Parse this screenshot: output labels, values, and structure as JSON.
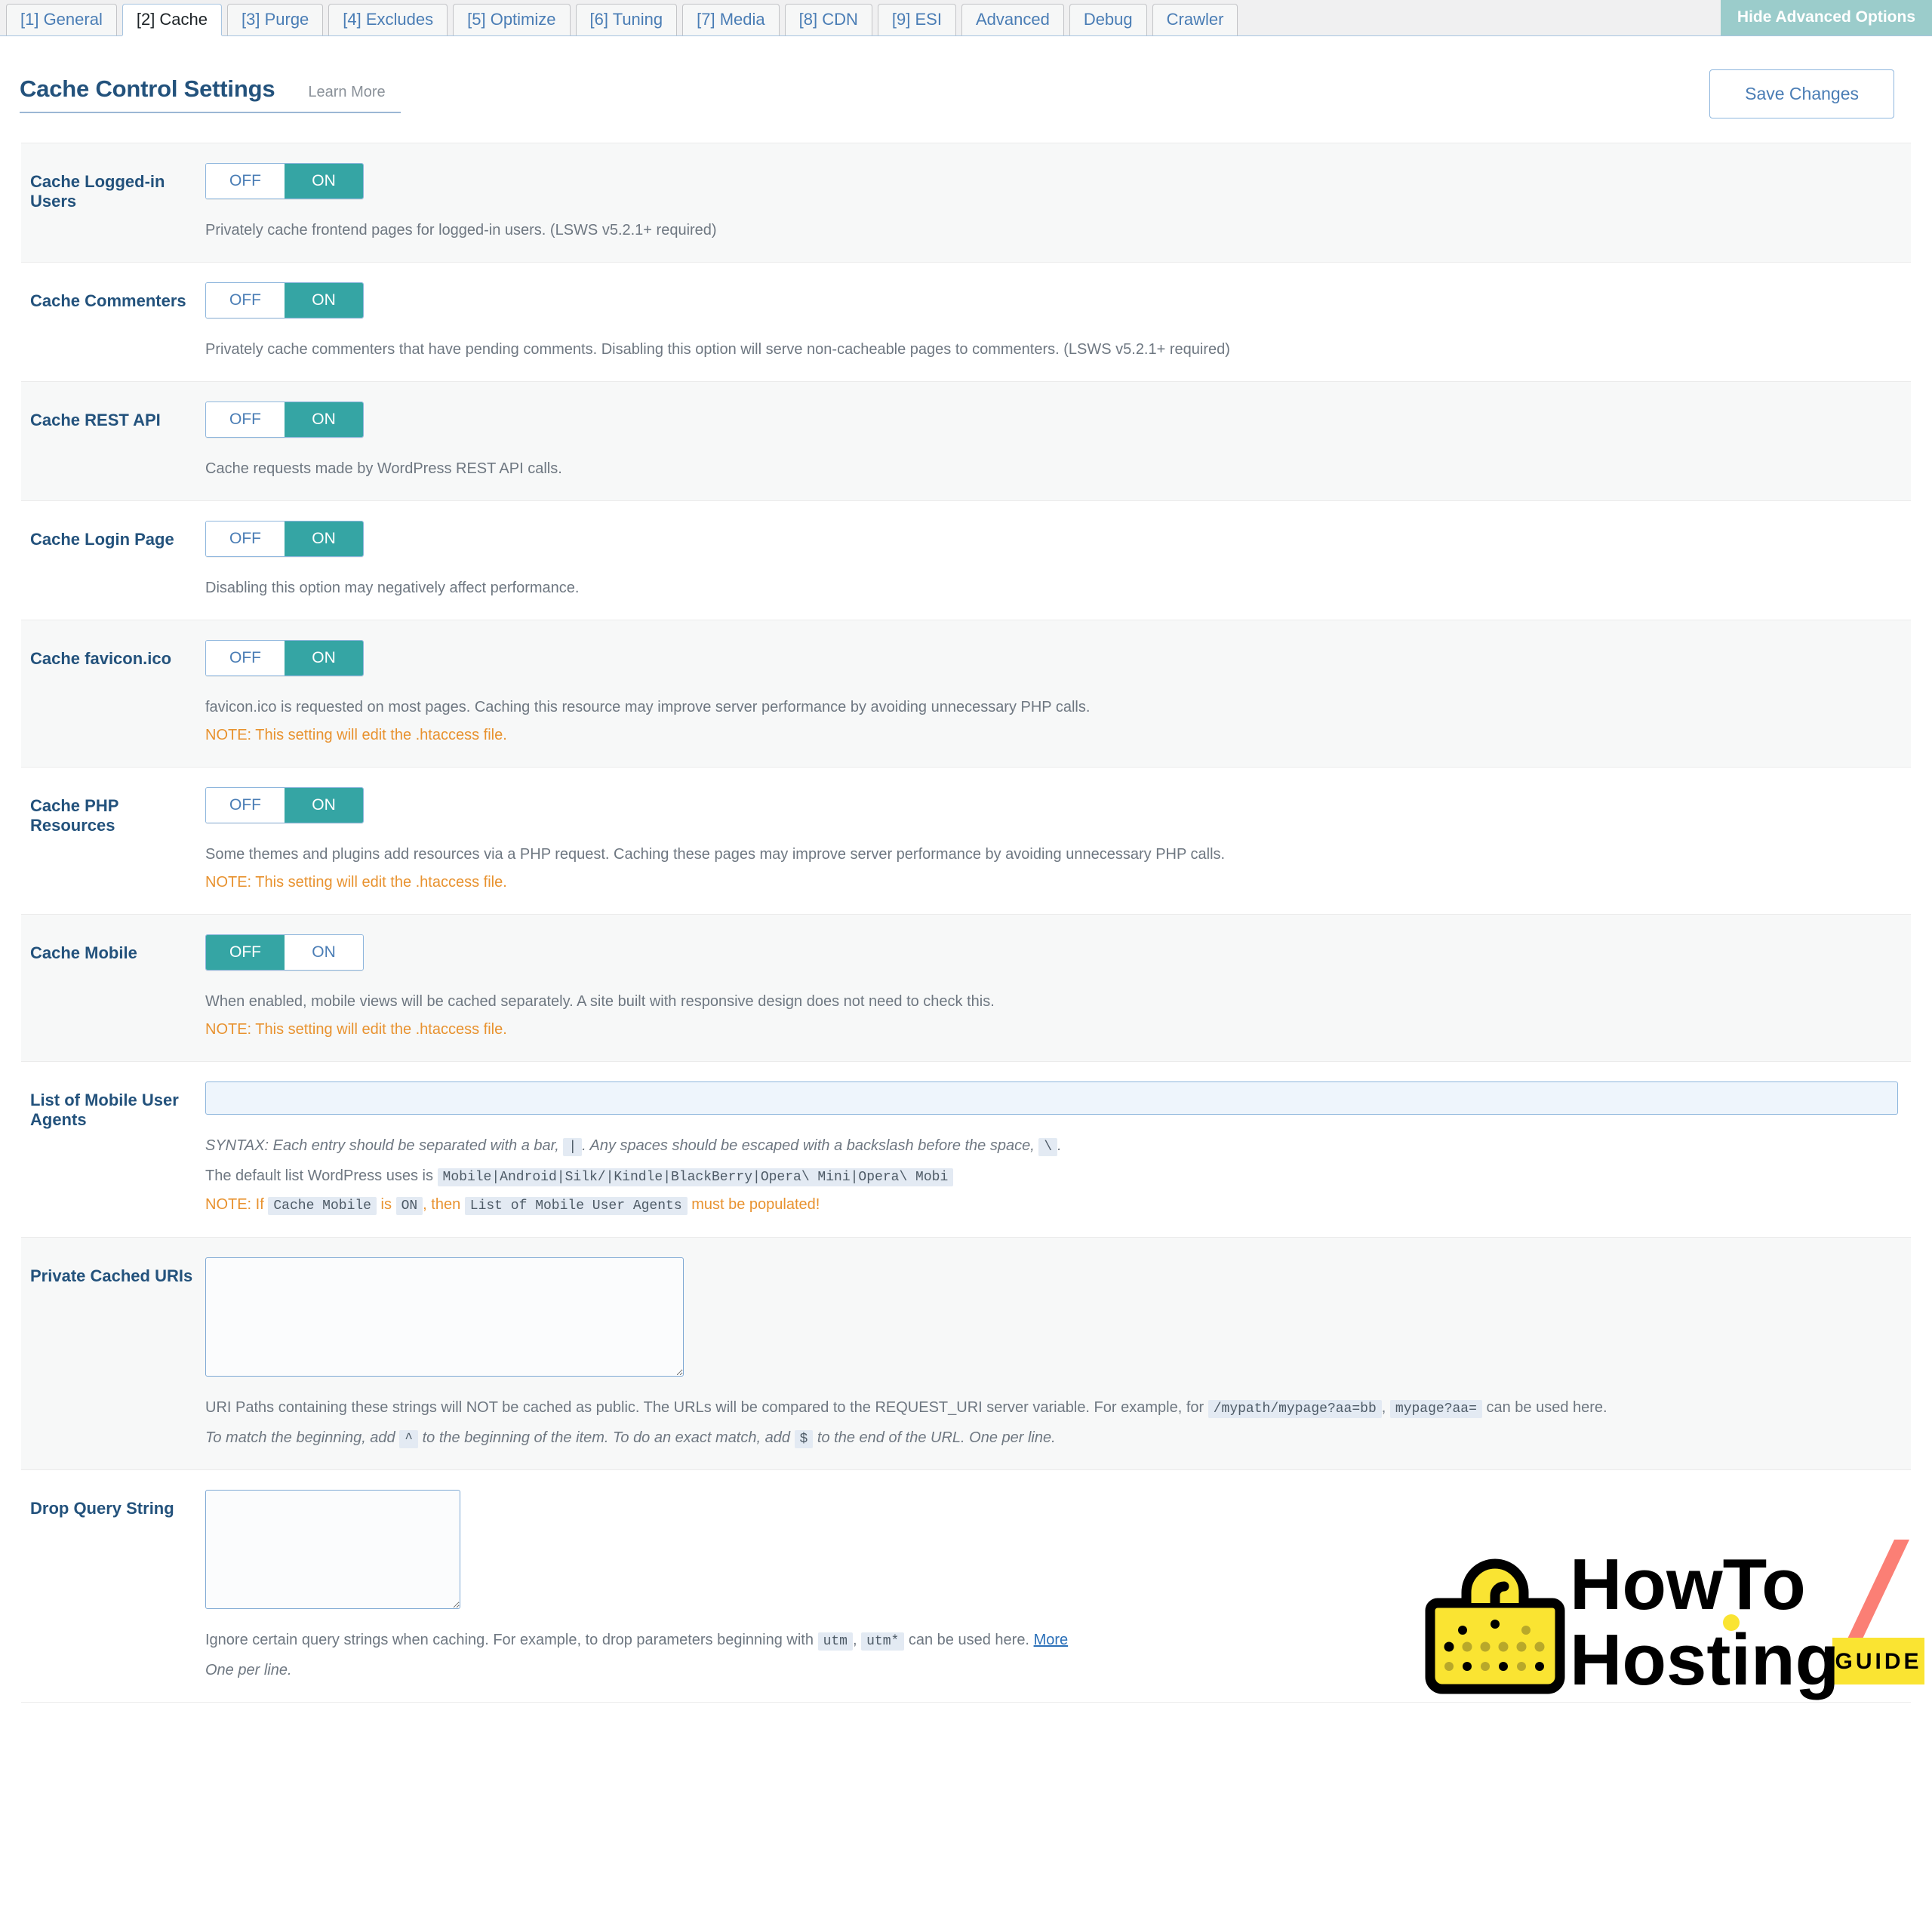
{
  "tabs": [
    {
      "label": "[1] General",
      "active": false
    },
    {
      "label": "[2] Cache",
      "active": true
    },
    {
      "label": "[3] Purge",
      "active": false
    },
    {
      "label": "[4] Excludes",
      "active": false
    },
    {
      "label": "[5] Optimize",
      "active": false
    },
    {
      "label": "[6] Tuning",
      "active": false
    },
    {
      "label": "[7] Media",
      "active": false
    },
    {
      "label": "[8] CDN",
      "active": false
    },
    {
      "label": "[9] ESI",
      "active": false
    },
    {
      "label": "Advanced",
      "active": false
    },
    {
      "label": "Debug",
      "active": false
    },
    {
      "label": "Crawler",
      "active": false
    }
  ],
  "advanced_options_button": "Hide Advanced Options",
  "header": {
    "title": "Cache Control Settings",
    "learn_more": "Learn More",
    "save_button": "Save Changes"
  },
  "toggle_labels": {
    "off": "OFF",
    "on": "ON"
  },
  "colors": {
    "accent_teal": "#35a5a4",
    "title_blue": "#23527c",
    "link_blue": "#4a7db5",
    "note_orange": "#e8922f",
    "advanced_btn": "#9bcccb"
  },
  "rows": [
    {
      "label": "Cache Logged-in Users",
      "state": "ON",
      "desc": "Privately cache frontend pages for logged-in users. (LSWS v5.2.1+ required)"
    },
    {
      "label": "Cache Commenters",
      "state": "ON",
      "desc": "Privately cache commenters that have pending comments. Disabling this option will serve non-cacheable pages to commenters. (LSWS v5.2.1+ required)"
    },
    {
      "label": "Cache REST API",
      "state": "ON",
      "desc": "Cache requests made by WordPress REST API calls."
    },
    {
      "label": "Cache Login Page",
      "state": "ON",
      "desc": "Disabling this option may negatively affect performance."
    },
    {
      "label": "Cache favicon.ico",
      "state": "ON",
      "desc": "favicon.ico is requested on most pages. Caching this resource may improve server performance by avoiding unnecessary PHP calls.",
      "note": "NOTE: This setting will edit the .htaccess file."
    },
    {
      "label": "Cache PHP Resources",
      "state": "ON",
      "desc": "Some themes and plugins add resources via a PHP request. Caching these pages may improve server performance by avoiding unnecessary PHP calls.",
      "note": "NOTE: This setting will edit the .htaccess file."
    },
    {
      "label": "Cache Mobile",
      "state": "OFF",
      "desc": "When enabled, mobile views will be cached separately. A site built with responsive design does not need to check this.",
      "note": "NOTE: This setting will edit the .htaccess file."
    }
  ],
  "mobile_agents": {
    "label": "List of Mobile User Agents",
    "value": "",
    "syntax_a": "SYNTAX: Each entry should be separated with a bar,",
    "syntax_code_bar": "|",
    "syntax_b": ". Any spaces should be escaped with a backslash before the space,",
    "syntax_code_backslash": "\\",
    "syntax_c": ".",
    "default_prefix": "The default list WordPress uses is",
    "default_code": "Mobile|Android|Silk/|Kindle|BlackBerry|Opera\\ Mini|Opera\\ Mobi",
    "note_a": "NOTE: If",
    "note_code_1": "Cache Mobile",
    "note_b": "is",
    "note_code_2": "ON",
    "note_c": ", then",
    "note_code_3": "List of Mobile User Agents",
    "note_d": "must be populated!"
  },
  "private_uris": {
    "label": "Private Cached URIs",
    "value": "",
    "desc_a": "URI Paths containing these strings will NOT be cached as public. The URLs will be compared to the REQUEST_URI server variable. For example, for",
    "code_1": "/mypath/mypage?aa=bb",
    "desc_b": ",",
    "code_2": "mypage?aa=",
    "desc_c": "can be used here.",
    "desc_d": "To match the beginning, add",
    "code_3": "^",
    "desc_e": "to the beginning of the item. To do an exact match, add",
    "code_4": "$",
    "desc_f": "to the end of the URL. One per line."
  },
  "drop_query": {
    "label": "Drop Query String",
    "value": "",
    "desc_a": "Ignore certain query strings when caching. For example, to drop parameters beginning with",
    "code_1": "utm",
    "desc_b": ",",
    "code_2": "utm*",
    "desc_c": "can be used here.",
    "link": "More",
    "desc_d": "One per line."
  },
  "logo": {
    "line1": "HowTo",
    "line2": "Hosting",
    "badge": "GUIDE"
  }
}
